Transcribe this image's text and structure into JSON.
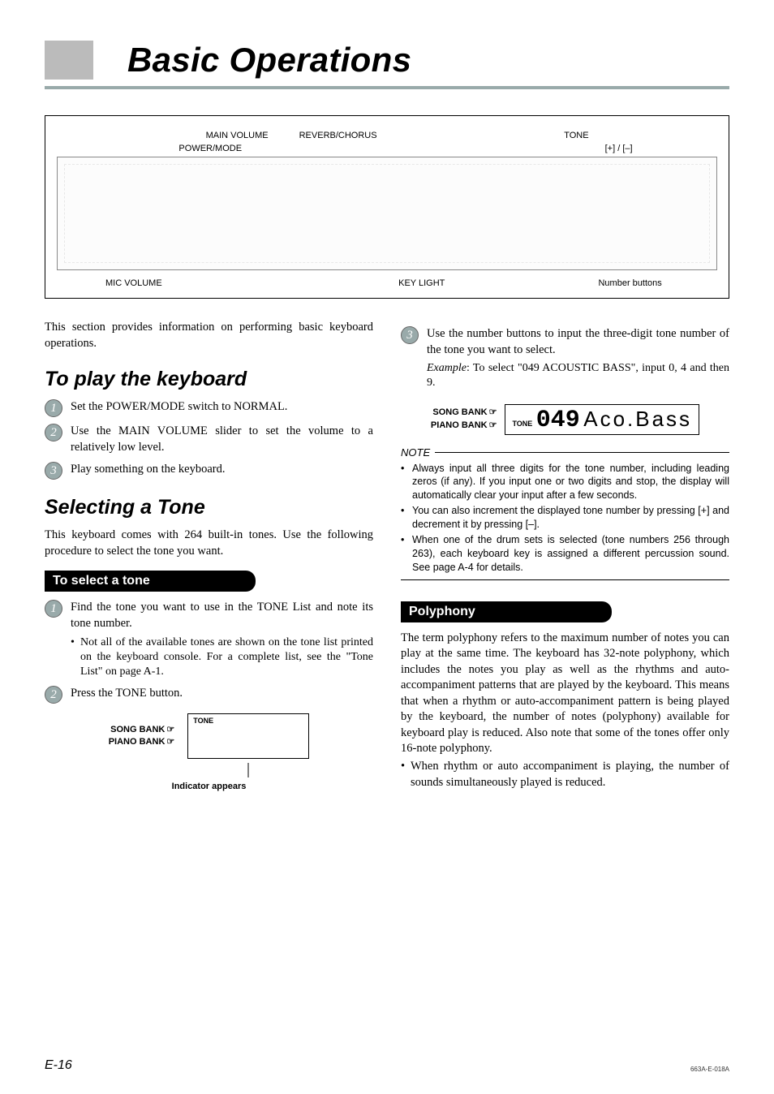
{
  "title": "Basic Operations",
  "diagram": {
    "top": {
      "main_volume": "MAIN VOLUME",
      "reverb_chorus": "REVERB/CHORUS",
      "tone": "TONE",
      "power_mode": "POWER/MODE",
      "plus_minus": "[+] / [–]"
    },
    "bottom": {
      "mic_volume": "MIC VOLUME",
      "key_light": "KEY LIGHT",
      "number_buttons": "Number buttons"
    }
  },
  "intro": "This section provides information on performing basic keyboard operations.",
  "play": {
    "heading": "To play the keyboard",
    "s1": "Set the POWER/MODE switch to NORMAL.",
    "s2": "Use the MAIN VOLUME slider to set the volume to a relatively low level.",
    "s3": "Play something on the keyboard."
  },
  "selecting": {
    "heading": "Selecting a Tone",
    "intro": "This keyboard comes with 264 built-in tones. Use the following procedure to select the tone you want.",
    "to_select_bar": "To select a tone",
    "s1": "Find the tone you want to use in the TONE List and note its tone number.",
    "s1_sub": "Not all of the available tones are shown on the tone list printed on the keyboard console. For a complete list, see the \"Tone List\" on page A-1.",
    "s2": "Press the TONE button.",
    "songbank": "SONG BANK",
    "pianobank": "PIANO BANK",
    "tone_label": "TONE",
    "indicator_caption": "Indicator appears"
  },
  "col2": {
    "s3": "Use the number buttons to input the three-digit tone number of the tone you want to select.",
    "example_label": "Example",
    "example_text": ": To select \"049 ACOUSTIC BASS\", input 0, 4 and then 9.",
    "lcd_digits": "049",
    "lcd_text": "Aco.Bass",
    "note_label": "NOTE",
    "note1": "Always input all three digits for the tone number, including leading zeros (if any). If you input one or two digits and stop, the display will automatically clear your input after a few seconds.",
    "note2": "You can also increment the displayed tone number by pressing [+] and decrement it by pressing [–].",
    "note3": "When one of the drum sets is selected (tone numbers 256 through 263), each keyboard key is assigned a different percussion sound. See page A-4 for details.",
    "poly_bar": "Polyphony",
    "poly_para": "The term polyphony refers to the maximum number of notes you can play at the same time. The keyboard has 32-note polyphony, which includes the notes you play as well as the rhythms and auto-accompaniment patterns that are played by the keyboard. This means that when a rhythm or auto-accompaniment pattern is being played by the keyboard, the number of notes (polyphony) available for keyboard play is reduced. Also note that some of the tones offer only 16-note polyphony.",
    "poly_bullet": "When rhythm or auto accompaniment is playing, the number of sounds simultaneously played is reduced."
  },
  "footer": {
    "page": "E-16",
    "code": "663A-E-018A"
  }
}
